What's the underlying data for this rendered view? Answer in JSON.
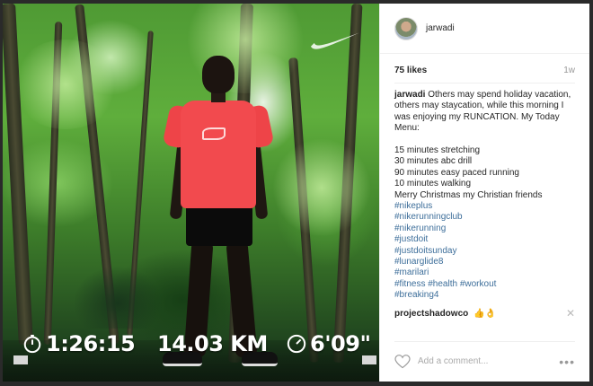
{
  "post": {
    "username": "jarwadi",
    "likes": "75 likes",
    "time_ago": "1w",
    "caption": {
      "username": "jarwadi",
      "text_lines": [
        "Others may spend holiday vacation, others may staycation, while this morning I was enjoying my RUNCATION. My Today Menu:",
        "",
        "15 minutes stretching",
        "30 minutes abc drill",
        "90 minutes easy paced running",
        "10 minutes walking",
        "Merry Christmas my Christian friends"
      ],
      "hashtags": [
        "#nikeplus",
        "#nikerunningclub",
        "#nikerunning",
        "#justdoit",
        "#justdoitsunday",
        "#lunarglide8",
        "#marilari",
        "#fitness #health #workout",
        "#breaking4"
      ]
    },
    "comment": {
      "username": "projectshadowco",
      "emoji": "👍👌"
    },
    "add_comment_placeholder": "Add a comment...",
    "more_icon": "more-options-icon"
  },
  "photo_overlay": {
    "duration": "1:26:15",
    "distance": "14.03 KM",
    "pace": "6'09\""
  },
  "colors": {
    "link": "#3d6e9a",
    "shirt": "#f24a4e"
  }
}
